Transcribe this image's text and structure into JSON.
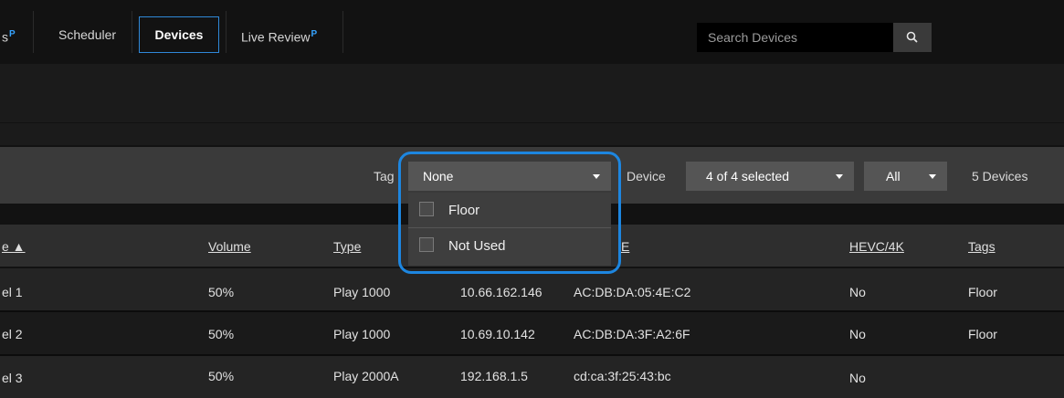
{
  "nav": {
    "items": [
      {
        "label": "s",
        "badge": "P"
      },
      {
        "label": "Scheduler"
      },
      {
        "label": "Devices",
        "active": true
      },
      {
        "label": "Live Review",
        "badge": "P"
      }
    ],
    "search_placeholder": "Search Devices"
  },
  "filters": {
    "tag_label": "Tag",
    "tag_value": "None",
    "tag_options": [
      "Floor",
      "Not Used"
    ],
    "device_label": "Device",
    "device_value": "4 of 4 selected",
    "all_value": "All",
    "count_text": "5 Devices"
  },
  "table": {
    "headers": [
      "e ▲",
      "Volume",
      "Type",
      "",
      "",
      "HEVC/4K",
      "Tags"
    ],
    "rows": [
      [
        "el 1",
        "50%",
        "Play 1000",
        "10.66.162.146",
        "AC:DB:DA:05:4E:C2",
        "No",
        "Floor"
      ],
      [
        "el 2",
        "50%",
        "Play 1000",
        "10.69.10.142",
        "AC:DB:DA:3F:A2:6F",
        "No",
        "Floor"
      ],
      [
        "el 3",
        "50%",
        "Play 2000A",
        "192.168.1.5",
        "cd:ca:3f:25:43:bc",
        "No",
        ""
      ]
    ],
    "partial_header_right": "E"
  },
  "colors": {
    "accent": "#1d86e0",
    "active_tab_border": "#2f88d8",
    "badge": "#36a3ff"
  },
  "icons": {
    "search": "search-icon",
    "caret": "caret-down-icon",
    "checkbox": "checkbox-icon"
  }
}
